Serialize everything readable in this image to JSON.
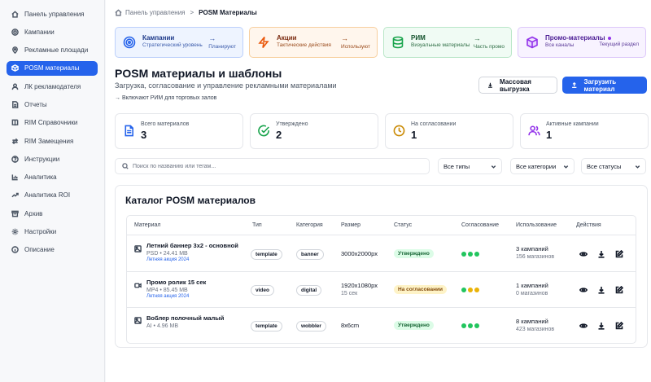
{
  "sidebar": {
    "items": [
      {
        "label": "Панель управления",
        "icon": "home-icon"
      },
      {
        "label": "Кампании",
        "icon": "target-icon"
      },
      {
        "label": "Рекламные площади",
        "icon": "map-pin-icon"
      },
      {
        "label": "POSM материалы",
        "icon": "box-icon",
        "active": true
      },
      {
        "label": "ЛК рекламодателя",
        "icon": "user-icon"
      },
      {
        "label": "Отчеты",
        "icon": "report-icon"
      },
      {
        "label": "RIM Справочники",
        "icon": "book-icon"
      },
      {
        "label": "RIM Замещения",
        "icon": "swap-icon"
      },
      {
        "label": "Инструкции",
        "icon": "help-icon"
      },
      {
        "label": "Аналитика",
        "icon": "chart-icon"
      },
      {
        "label": "Аналитика ROI",
        "icon": "trend-icon"
      },
      {
        "label": "Архив",
        "icon": "archive-icon"
      },
      {
        "label": "Настройки",
        "icon": "gear-icon"
      },
      {
        "label": "Описание",
        "icon": "info-icon"
      }
    ]
  },
  "breadcrumb": {
    "root": "Панель управления",
    "separator": ">",
    "current": "POSM Материалы"
  },
  "quick_cards": [
    {
      "title": "Кампании",
      "subtitle": "Стратегический уровень",
      "right": "Планируют",
      "icon": "target-icon"
    },
    {
      "title": "Акции",
      "subtitle": "Тактические действия",
      "right": "Используют",
      "icon": "zap-icon"
    },
    {
      "title": "РИМ",
      "subtitle": "Визуальные материалы",
      "right": "Часть промо",
      "icon": "database-icon"
    },
    {
      "title": "Промо-материалы",
      "subtitle": "Все каналы",
      "right": "Текущий раздел",
      "icon": "cube-icon"
    }
  ],
  "page": {
    "title": "POSM материалы и шаблоны",
    "subtitle": "Загрузка, согласование и управление рекламными материалами",
    "link": "→ Включают РИМ для торговых залов",
    "bulk_export": "Массовая выгрузка",
    "upload": "Загрузить материал"
  },
  "stats": [
    {
      "label": "Всего материалов",
      "value": "3",
      "icon": "file-icon",
      "color": "#2563eb"
    },
    {
      "label": "Утверждено",
      "value": "2",
      "icon": "check-circle-icon",
      "color": "#16a34a"
    },
    {
      "label": "На согласовании",
      "value": "1",
      "icon": "clock-icon",
      "color": "#ca8a04"
    },
    {
      "label": "Активные кампании",
      "value": "1",
      "icon": "users-icon",
      "color": "#9333ea"
    }
  ],
  "filters": {
    "search_placeholder": "Поиск по названию или тегам...",
    "types": "Все типы",
    "categories": "Все категории",
    "statuses": "Все статусы"
  },
  "catalog": {
    "title": "Каталог POSM материалов",
    "columns": [
      "Материал",
      "Тип",
      "Категория",
      "Размер",
      "Статус",
      "Согласование",
      "Использование",
      "Действия"
    ],
    "rows": [
      {
        "name": "Летний баннер 3x2 - основной",
        "meta": "PSD • 24.41 MB",
        "campaign": "Летняя акция 2024",
        "type": "template",
        "category": "banner",
        "size": "3000x2000px",
        "size_sub": "",
        "status": "Утверждено",
        "status_kind": "ok",
        "approvals": [
          "g",
          "g",
          "g"
        ],
        "usage": "3 кампаний",
        "usage_sub": "156 магазинов",
        "icon": "image-icon"
      },
      {
        "name": "Промо ролик 15 сек",
        "meta": "MP4 • 85.45 MB",
        "campaign": "Летняя акция 2024",
        "type": "video",
        "category": "digital",
        "size": "1920x1080px",
        "size_sub": "15 сек",
        "status": "На согласовании",
        "status_kind": "wait",
        "approvals": [
          "g",
          "y",
          "y"
        ],
        "usage": "1 кампаний",
        "usage_sub": "0 магазинов",
        "icon": "video-icon"
      },
      {
        "name": "Воблер полочный малый",
        "meta": "AI • 4.96 MB",
        "campaign": "",
        "type": "template",
        "category": "wobbler",
        "size": "8x6cm",
        "size_sub": "",
        "status": "Утверждено",
        "status_kind": "ok",
        "approvals": [
          "g",
          "g",
          "g"
        ],
        "usage": "8 кампаний",
        "usage_sub": "423 магазинов",
        "icon": "image-icon"
      }
    ]
  }
}
